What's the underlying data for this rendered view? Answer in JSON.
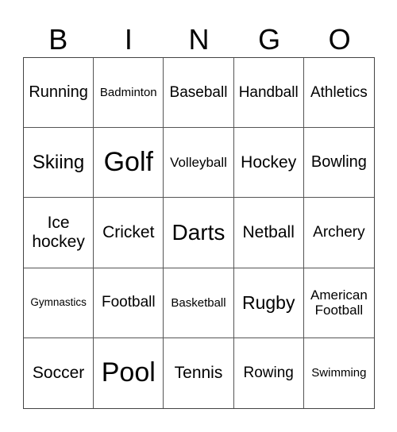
{
  "header": [
    "B",
    "I",
    "N",
    "G",
    "O"
  ],
  "cells": [
    "Running",
    "Badminton",
    "Baseball",
    "Handball",
    "Athletics",
    "Skiing",
    "Golf",
    "Volleyball",
    "Hockey",
    "Bowling",
    "Ice hockey",
    "Cricket",
    "Darts",
    "Netball",
    "Archery",
    "Gymnastics",
    "Football",
    "Basketball",
    "Rugby",
    "American Football",
    "Soccer",
    "Pool",
    "Tennis",
    "Rowing",
    "Swimming"
  ]
}
